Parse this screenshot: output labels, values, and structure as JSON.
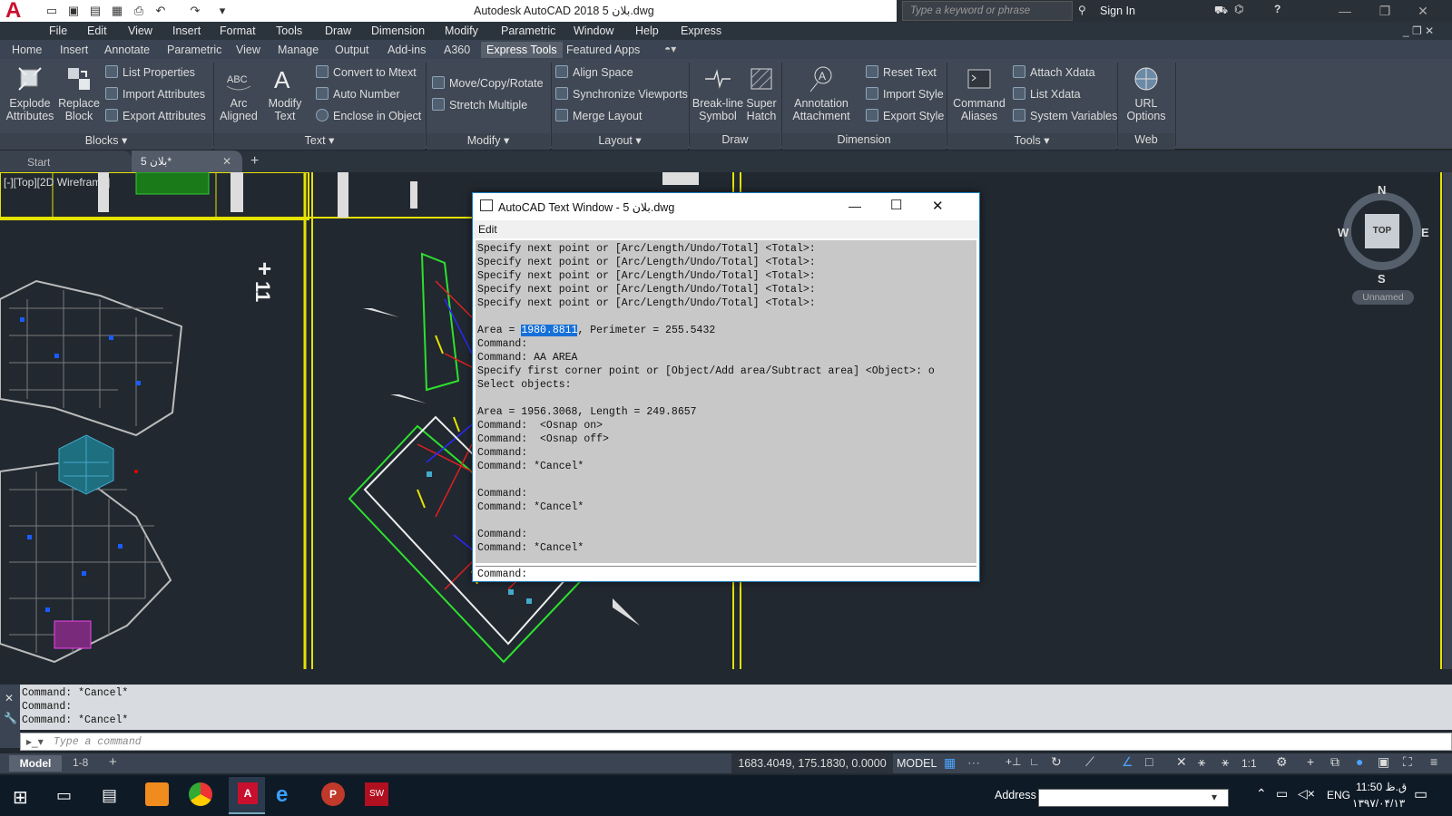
{
  "app": {
    "title": "Autodesk AutoCAD 2018    بلان 5.dwg",
    "search_placeholder": "Type a keyword or phrase",
    "sign_in": "Sign In"
  },
  "menubar": [
    "File",
    "Edit",
    "View",
    "Insert",
    "Format",
    "Tools",
    "Draw",
    "Dimension",
    "Modify",
    "Parametric",
    "Window",
    "Help",
    "Express"
  ],
  "ribbon_tabs": [
    "Home",
    "Insert",
    "Annotate",
    "Parametric",
    "View",
    "Manage",
    "Output",
    "Add-ins",
    "A360",
    "Express Tools",
    "Featured Apps"
  ],
  "ribbon_active": "Express Tools",
  "panels": {
    "blocks": {
      "title": "Blocks",
      "big": [
        {
          "l1": "Explode",
          "l2": "Attributes"
        },
        {
          "l1": "Replace",
          "l2": "Block"
        }
      ],
      "small": [
        "List Properties",
        "Import Attributes",
        "Export Attributes"
      ]
    },
    "text": {
      "title": "Text",
      "big": [
        {
          "l1": "Arc",
          "l2": "Aligned"
        },
        {
          "l1": "Modify",
          "l2": "Text"
        }
      ],
      "small": [
        "Convert to Mtext",
        "Auto Number",
        "Enclose in Object"
      ]
    },
    "modify": {
      "title": "Modify",
      "small": [
        "Move/Copy/Rotate",
        "Stretch Multiple"
      ]
    },
    "layout": {
      "title": "Layout",
      "small": [
        "Align Space",
        "Synchronize Viewports",
        "Merge Layout"
      ]
    },
    "draw": {
      "title": "Draw",
      "big": [
        {
          "l1": "Break-line",
          "l2": "Symbol"
        },
        {
          "l1": "Super",
          "l2": "Hatch"
        }
      ]
    },
    "dimension": {
      "title": "Dimension",
      "big": [
        {
          "l1": "Annotation",
          "l2": "Attachment"
        }
      ],
      "small": [
        "Reset Text",
        "Import Style",
        "Export Style"
      ]
    },
    "tools": {
      "title": "Tools",
      "big": [
        {
          "l1": "Command",
          "l2": "Aliases"
        }
      ],
      "small": [
        "Attach Xdata",
        "List Xdata",
        "System Variables"
      ]
    },
    "web": {
      "title": "Web",
      "big": [
        {
          "l1": "URL",
          "l2": "Options"
        }
      ]
    }
  },
  "doc_tabs": {
    "start": "Start",
    "plan": "بلان 5*"
  },
  "viewport_label": "[-][Top][2D Wireframe]",
  "viewcube": {
    "n": "N",
    "s": "S",
    "e": "E",
    "w": "W",
    "top": "TOP",
    "ucs": "Unnamed"
  },
  "text_window": {
    "title": "AutoCAD Text Window - بلان 5.dwg",
    "menu": "Edit",
    "lines_before": "Specify next point or [Arc/Length/Undo/Total] <Total>:\nSpecify next point or [Arc/Length/Undo/Total] <Total>:\nSpecify next point or [Arc/Length/Undo/Total] <Total>:\nSpecify next point or [Arc/Length/Undo/Total] <Total>:\nSpecify next point or [Arc/Length/Undo/Total] <Total>:\n\n",
    "area_prefix": "Area = ",
    "area_value": "1980.8811",
    "area_suffix": ", Perimeter = 255.5432",
    "lines_after": "\nCommand:\nCommand: AA AREA\nSpecify first corner point or [Object/Add area/Subtract area] <Object>: o\nSelect objects:\n\nArea = 1956.3068, Length = 249.8657\nCommand:  <Osnap on>\nCommand:  <Osnap off>\nCommand:\nCommand: *Cancel*\n\nCommand:\nCommand: *Cancel*\n\nCommand:\nCommand: *Cancel*",
    "command_prompt": "Command:"
  },
  "command_history": "Command: *Cancel*\nCommand:\nCommand: *Cancel*",
  "command_placeholder": "Type a command",
  "layout_tabs": [
    "Model",
    "1-8"
  ],
  "status": {
    "coords": "1683.4049, 175.1830, 0.0000",
    "model": "MODEL",
    "scale": "1:1"
  },
  "taskbar": {
    "address_label": "Address",
    "lang": "ENG",
    "time": "11:50 ق.ظ",
    "date": "۱۳۹۷/۰۴/۱۳"
  },
  "colors": {
    "accent": "#1670d8",
    "ribbon": "#3f4854",
    "drawing_bg": "#212830"
  }
}
